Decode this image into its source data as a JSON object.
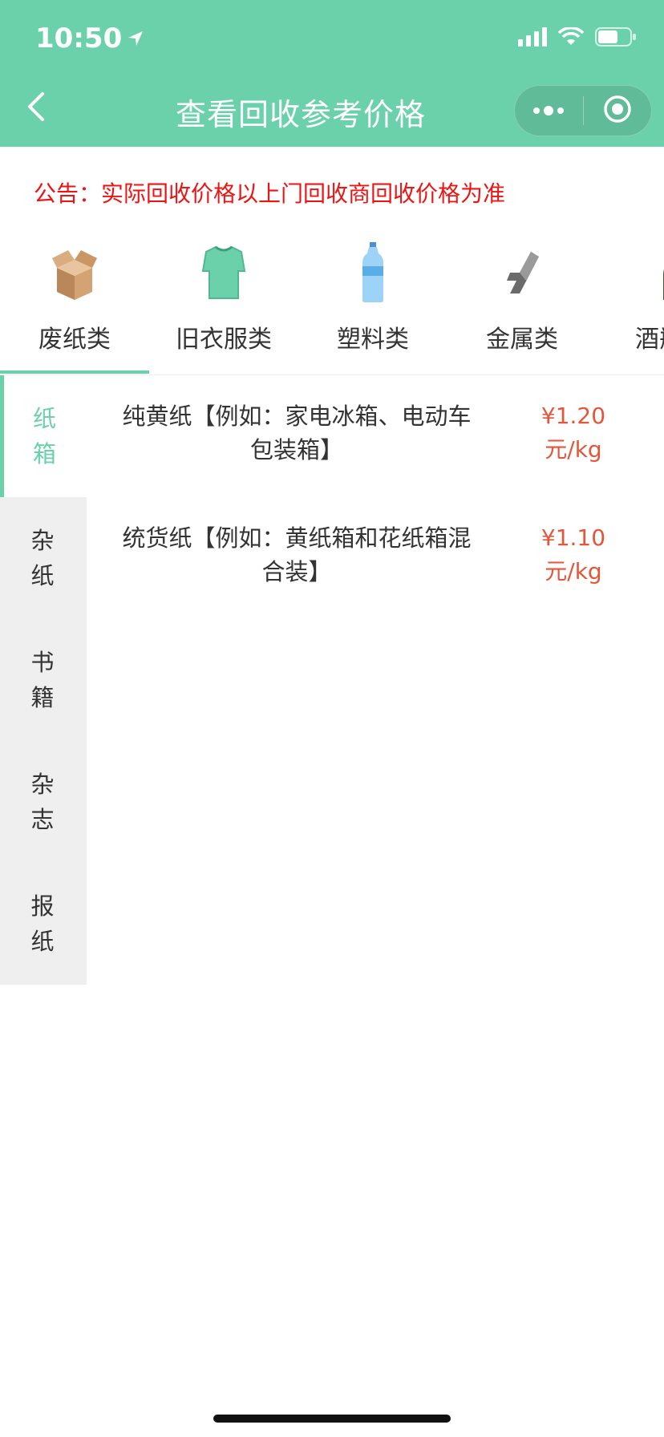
{
  "status_bar": {
    "time": "10:50"
  },
  "nav": {
    "title": "查看回收参考价格"
  },
  "notice": "公告：实际回收价格以上门回收商回收价格为准",
  "categories": [
    {
      "label": "废纸类",
      "icon": "cardboard-box-icon"
    },
    {
      "label": "旧衣服类",
      "icon": "tshirt-icon"
    },
    {
      "label": "塑料类",
      "icon": "water-bottle-icon"
    },
    {
      "label": "金属类",
      "icon": "metal-beam-icon"
    },
    {
      "label": "酒瓶类",
      "icon": "wine-bottle-icon"
    }
  ],
  "selected_category": "废纸类",
  "subcategories": [
    {
      "label": "纸箱",
      "active": true
    },
    {
      "label": "杂纸",
      "active": false
    },
    {
      "label": "书籍",
      "active": false
    },
    {
      "label": "杂志",
      "active": false
    },
    {
      "label": "报纸",
      "active": false
    }
  ],
  "products": [
    {
      "name": "纯黄纸【例如：家电冰箱、电动车包装箱】",
      "price": "¥1.20元/kg"
    },
    {
      "name": "统货纸【例如：黄纸箱和花纸箱混合装】",
      "price": "¥1.10元/kg"
    }
  ],
  "colors": {
    "accent": "#6bd1aa",
    "notice": "#ee1414",
    "price": "#e4563a",
    "sidebar_bg": "#efefef"
  }
}
